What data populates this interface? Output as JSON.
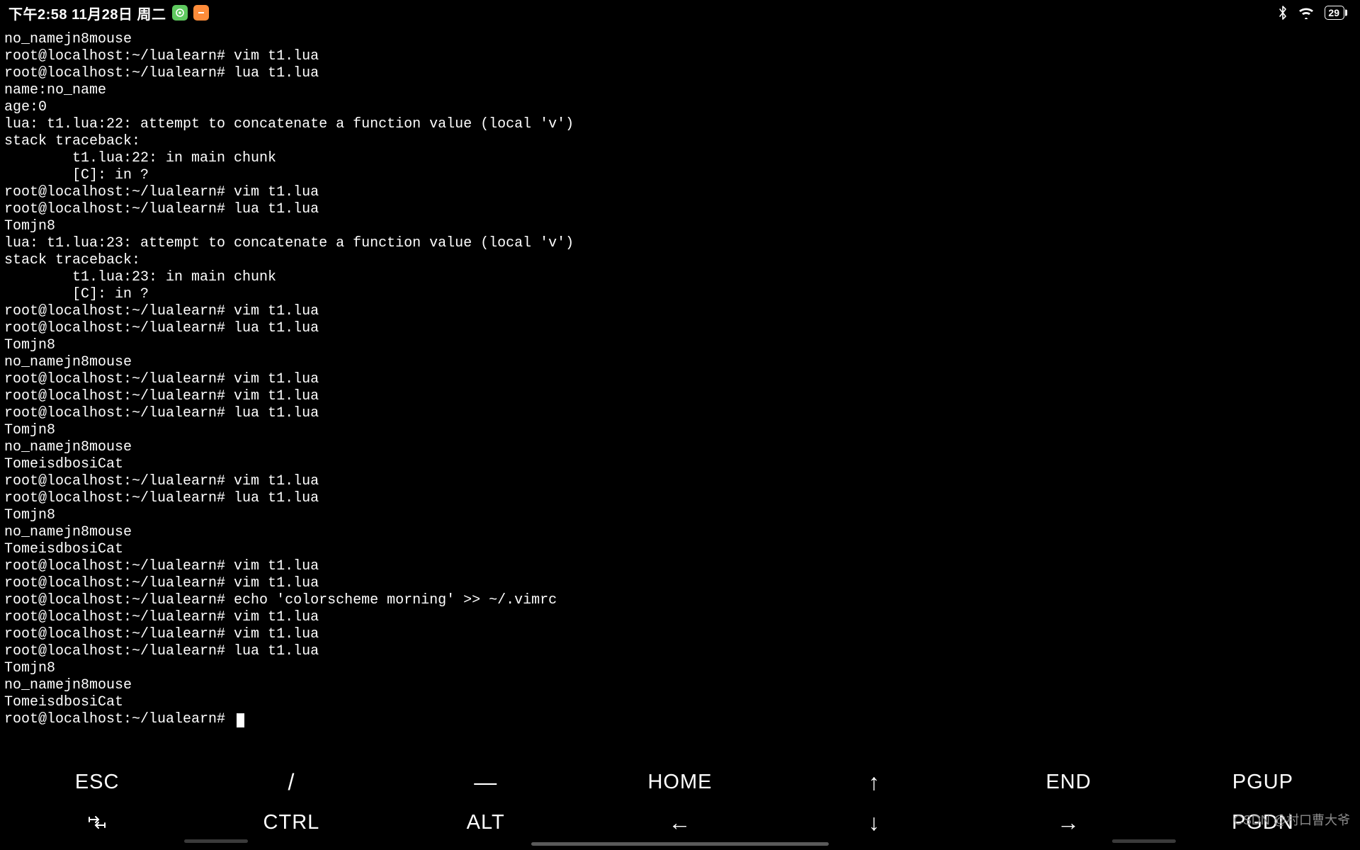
{
  "status": {
    "time": "下午2:58 11月28日 周二",
    "battery": "29"
  },
  "terminal": {
    "lines": [
      "no_namejn8mouse",
      "root@localhost:~/lualearn# vim t1.lua",
      "root@localhost:~/lualearn# lua t1.lua",
      "name:no_name",
      "age:0",
      "lua: t1.lua:22: attempt to concatenate a function value (local 'v')",
      "stack traceback:",
      "        t1.lua:22: in main chunk",
      "        [C]: in ?",
      "root@localhost:~/lualearn# vim t1.lua",
      "root@localhost:~/lualearn# lua t1.lua",
      "Tomjn8",
      "lua: t1.lua:23: attempt to concatenate a function value (local 'v')",
      "stack traceback:",
      "        t1.lua:23: in main chunk",
      "        [C]: in ?",
      "root@localhost:~/lualearn# vim t1.lua",
      "root@localhost:~/lualearn# lua t1.lua",
      "Tomjn8",
      "no_namejn8mouse",
      "root@localhost:~/lualearn# vim t1.lua",
      "root@localhost:~/lualearn# vim t1.lua",
      "root@localhost:~/lualearn# lua t1.lua",
      "Tomjn8",
      "no_namejn8mouse",
      "TomeisdbosiCat",
      "root@localhost:~/lualearn# vim t1.lua",
      "root@localhost:~/lualearn# lua t1.lua",
      "Tomjn8",
      "no_namejn8mouse",
      "TomeisdbosiCat",
      "root@localhost:~/lualearn# vim t1.lua",
      "root@localhost:~/lualearn# vim t1.lua",
      "root@localhost:~/lualearn# echo 'colorscheme morning' >> ~/.vimrc",
      "root@localhost:~/lualearn# vim t1.lua",
      "root@localhost:~/lualearn# vim t1.lua",
      "root@localhost:~/lualearn# lua t1.lua",
      "Tomjn8",
      "no_namejn8mouse",
      "TomeisdbosiCat"
    ],
    "prompt": "root@localhost:~/lualearn# "
  },
  "keyboard": {
    "row1": [
      "ESC",
      "/",
      "—",
      "HOME",
      "↑",
      "END",
      "PGUP"
    ],
    "row2_labels": [
      "tab",
      "CTRL",
      "ALT",
      "←",
      "↓",
      "→",
      "PGDN"
    ]
  },
  "watermark": "CSDN @村口曹大爷"
}
